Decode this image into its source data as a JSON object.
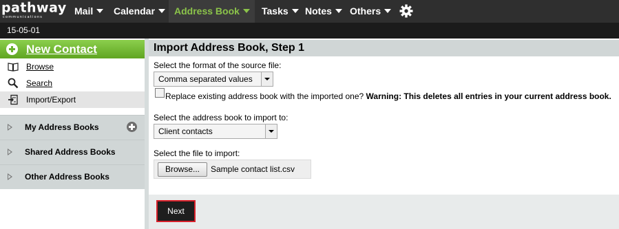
{
  "brand": {
    "logo_word": "pathway",
    "logo_sub": "communications"
  },
  "nav": {
    "items": [
      {
        "label": "Mail",
        "active": false
      },
      {
        "label": "Calendar",
        "active": false
      },
      {
        "label": "Address Book",
        "active": true
      },
      {
        "label": "Tasks",
        "active": false
      },
      {
        "label": "Notes",
        "active": false
      },
      {
        "label": "Others",
        "active": false
      }
    ],
    "settings_icon": "gear-icon",
    "accent_color": "#8bc34a"
  },
  "date": "15-05-01",
  "sidebar": {
    "new_contact": "New Contact",
    "links": [
      {
        "label": "Browse",
        "icon": "book-icon"
      },
      {
        "label": "Search",
        "icon": "magnifier-icon"
      },
      {
        "label": "Import/Export",
        "icon": "import-export-icon"
      }
    ],
    "sections": [
      {
        "label": "My Address Books"
      },
      {
        "label": "Shared Address Books"
      },
      {
        "label": "Other Address Books"
      }
    ]
  },
  "main": {
    "title": "Import Address Book, Step 1",
    "format_label": "Select the format of the source file:",
    "format_value": "Comma separated values",
    "replace_text": "Replace existing address book with the imported one?",
    "warning_text": "Warning: This deletes all entries in your current address book.",
    "replace_checked": false,
    "book_label": "Select the address book to import to:",
    "book_value": "Client contacts",
    "file_label": "Select the file to import:",
    "browse_label": "Browse...",
    "file_name": "Sample contact list.csv",
    "next_label": "Next",
    "highlight_color": "#d8202a"
  }
}
